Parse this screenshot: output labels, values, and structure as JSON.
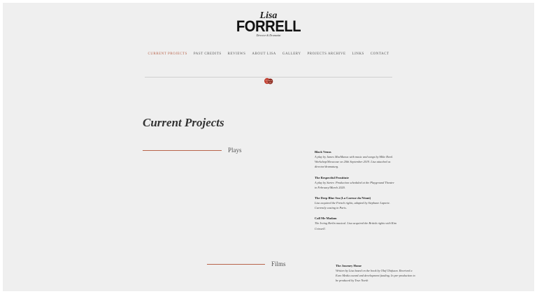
{
  "logo": {
    "first_name": "Lisa",
    "last_name": "FORRELL",
    "tagline": "Director & Dramatist"
  },
  "nav": {
    "items": [
      {
        "label": "CURRENT PROJECTS",
        "active": true
      },
      {
        "label": "PAST CREDITS",
        "active": false
      },
      {
        "label": "REVIEWS",
        "active": false
      },
      {
        "label": "ABOUT LISA",
        "active": false
      },
      {
        "label": "GALLERY",
        "active": false
      },
      {
        "label": "PROJECTS ARCHIVE",
        "active": false
      },
      {
        "label": "LINKS",
        "active": false
      },
      {
        "label": "CONTACT",
        "active": false
      }
    ]
  },
  "divider_icon": "theatre-masks-icon",
  "page_title": "Current Projects",
  "sections": [
    {
      "label": "Plays",
      "projects": [
        {
          "title": "Black Venus",
          "description": "A play by James MacManus with music and songs by Mike Reed. Workshop/Showcase on 20th September 2019. Lisa attached as director/dramaturg."
        },
        {
          "title": "The Respectful Prostitute",
          "description": "A play by Sartre. Production scheduled at the Playground Theatre in February/March 2020."
        },
        {
          "title": "The Deep Blue Sea (La Caresse du Néant)",
          "description": "Lisa acquired the French rights, adapted by Stephane Laporte. Currently casting in Paris."
        },
        {
          "title": "Call Me Madam",
          "description": "The Irving Berlin musical. Lisa acquired the British rights with Kim Criswell."
        }
      ]
    },
    {
      "label": "Films",
      "projects": [
        {
          "title": "The Journey Home",
          "description": "Written by Lisa based on the book by Olaf Olafsson. Received a Euro Media award and development funding. In pre-production to be produced by True North"
        }
      ]
    }
  ],
  "colors": {
    "accent": "#b8634a",
    "background": "#efefef",
    "text": "#333333"
  }
}
